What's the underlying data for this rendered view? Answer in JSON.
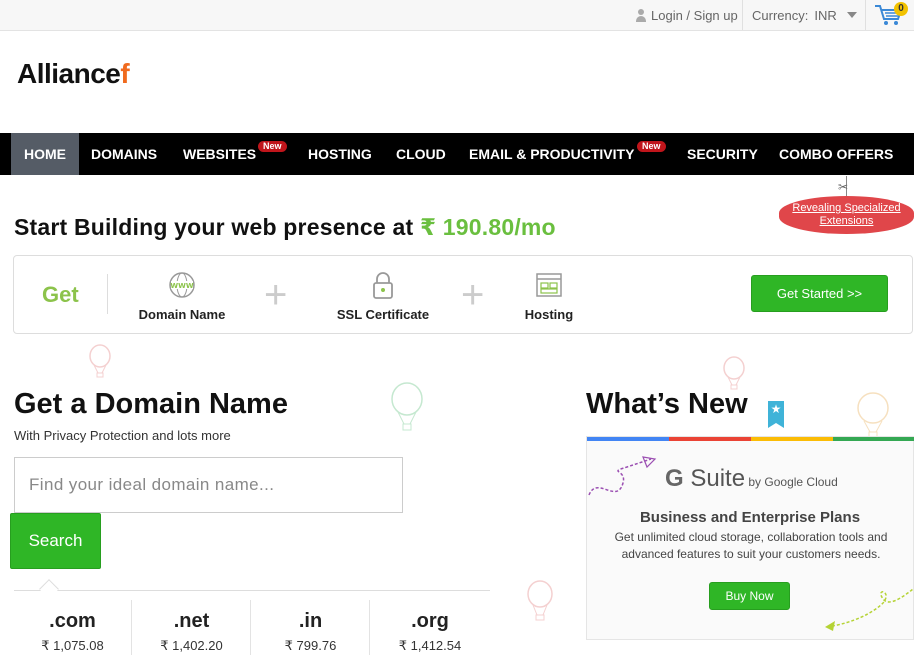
{
  "topbar": {
    "login_label": "Login / Sign up",
    "currency_label": "Currency:",
    "currency_value": "INR",
    "cart_count": "0"
  },
  "logo": {
    "text_main": "Alliance",
    "text_accent": "f"
  },
  "nav": {
    "items": [
      {
        "label": "HOME",
        "active": true
      },
      {
        "label": "DOMAINS"
      },
      {
        "label": "WEBSITES",
        "badge": "New"
      },
      {
        "label": "HOSTING"
      },
      {
        "label": "CLOUD"
      },
      {
        "label": "EMAIL & PRODUCTIVITY",
        "badge": "New"
      },
      {
        "label": "SECURITY"
      },
      {
        "label": "COMBO OFFERS"
      }
    ]
  },
  "ribbon": {
    "line1": "Revealing Specialized",
    "line2": "Extensions"
  },
  "hero": {
    "headline": "Start Building your web presence at",
    "currency_symbol": "₹",
    "price": "190.80/mo"
  },
  "getbar": {
    "get_label": "Get",
    "features": [
      "Domain Name",
      "SSL Certificate",
      "Hosting"
    ],
    "cta_label": "Get Started >>"
  },
  "domain": {
    "title": "Get a Domain Name",
    "subtitle": "With Privacy Protection and lots more",
    "placeholder": "Find your ideal domain name...",
    "search_label": "Search",
    "tlds": [
      {
        "name": ".com",
        "price": "₹ 1,075.08"
      },
      {
        "name": ".net",
        "price": "₹ 1,402.20"
      },
      {
        "name": ".in",
        "price": "₹ 799.76"
      },
      {
        "name": ".org",
        "price": "₹ 1,412.54"
      }
    ]
  },
  "whats_new": {
    "title": "What’s New",
    "gsuite_g": "G",
    "gsuite_suite": " Suite",
    "gsuite_by": " by Google Cloud",
    "heading": "Business and Enterprise Plans",
    "description": "Get unlimited cloud storage, collaboration tools and advanced features to suit your customers needs.",
    "cta_label": "Buy Now"
  },
  "colors": {
    "accent_green": "#2fb626",
    "price_green": "#6abf3f",
    "nav_bg": "#000000",
    "nav_active": "#555c66",
    "badge_red": "#c0151b",
    "logo_orange": "#f06a1e",
    "gsuite_blue": "#4285f4",
    "gsuite_red": "#ea4335",
    "gsuite_yellow": "#fbbc05",
    "gsuite_green": "#34a853"
  }
}
